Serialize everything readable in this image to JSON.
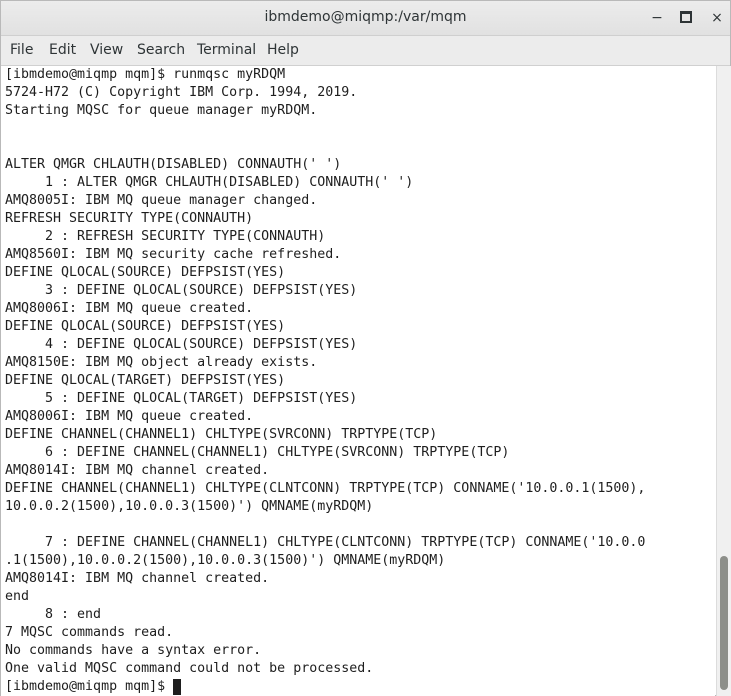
{
  "window": {
    "title": "ibmdemo@miqmp:/var/mqm",
    "controls": {
      "minimize": "−",
      "close": "×"
    }
  },
  "menu": {
    "file": "File",
    "edit": "Edit",
    "view": "View",
    "search": "Search",
    "terminal": "Terminal",
    "help": "Help"
  },
  "terminal": {
    "lines": [
      "[ibmdemo@miqmp mqm]$ runmqsc myRDQM",
      "5724-H72 (C) Copyright IBM Corp. 1994, 2019.",
      "Starting MQSC for queue manager myRDQM.",
      "",
      "",
      "ALTER QMGR CHLAUTH(DISABLED) CONNAUTH(' ')",
      "     1 : ALTER QMGR CHLAUTH(DISABLED) CONNAUTH(' ')",
      "AMQ8005I: IBM MQ queue manager changed.",
      "REFRESH SECURITY TYPE(CONNAUTH)",
      "     2 : REFRESH SECURITY TYPE(CONNAUTH)",
      "AMQ8560I: IBM MQ security cache refreshed.",
      "DEFINE QLOCAL(SOURCE) DEFPSIST(YES)",
      "     3 : DEFINE QLOCAL(SOURCE) DEFPSIST(YES)",
      "AMQ8006I: IBM MQ queue created.",
      "DEFINE QLOCAL(SOURCE) DEFPSIST(YES)",
      "     4 : DEFINE QLOCAL(SOURCE) DEFPSIST(YES)",
      "AMQ8150E: IBM MQ object already exists.",
      "DEFINE QLOCAL(TARGET) DEFPSIST(YES)",
      "     5 : DEFINE QLOCAL(TARGET) DEFPSIST(YES)",
      "AMQ8006I: IBM MQ queue created.",
      "DEFINE CHANNEL(CHANNEL1) CHLTYPE(SVRCONN) TRPTYPE(TCP)",
      "     6 : DEFINE CHANNEL(CHANNEL1) CHLTYPE(SVRCONN) TRPTYPE(TCP)",
      "AMQ8014I: IBM MQ channel created.",
      "DEFINE CHANNEL(CHANNEL1) CHLTYPE(CLNTCONN) TRPTYPE(TCP) CONNAME('10.0.0.1(1500),",
      "10.0.0.2(1500),10.0.0.3(1500)') QMNAME(myRDQM)",
      "",
      "     7 : DEFINE CHANNEL(CHANNEL1) CHLTYPE(CLNTCONN) TRPTYPE(TCP) CONNAME('10.0.0",
      ".1(1500),10.0.0.2(1500),10.0.0.3(1500)') QMNAME(myRDQM)",
      "AMQ8014I: IBM MQ channel created.",
      "end",
      "     8 : end",
      "7 MQSC commands read.",
      "No commands have a syntax error.",
      "One valid MQSC command could not be processed."
    ],
    "prompt": "[ibmdemo@miqmp mqm]$ "
  }
}
